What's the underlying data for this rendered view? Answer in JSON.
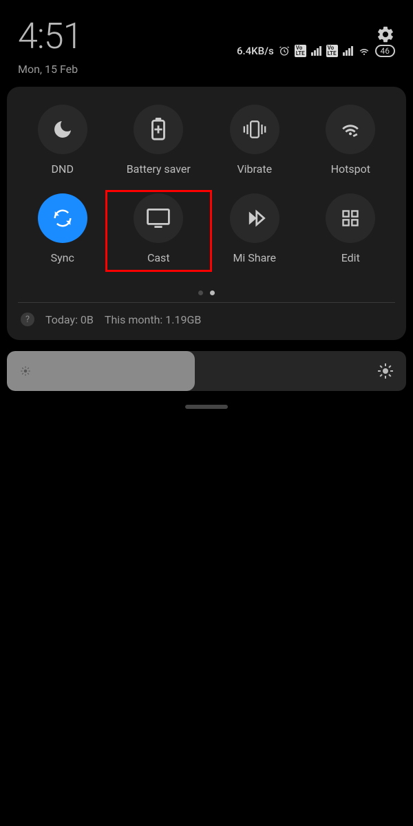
{
  "clock": "4:51",
  "date": "Mon, 15 Feb",
  "network_speed": "6.4KB/s",
  "battery_level": "46",
  "tiles": [
    {
      "label": "DND",
      "icon": "moon",
      "active": false
    },
    {
      "label": "Battery saver",
      "icon": "battery-plus",
      "active": false
    },
    {
      "label": "Vibrate",
      "icon": "vibrate",
      "active": false
    },
    {
      "label": "Hotspot",
      "icon": "hotspot",
      "active": false
    },
    {
      "label": "Sync",
      "icon": "sync",
      "active": true
    },
    {
      "label": "Cast",
      "icon": "cast",
      "active": false,
      "highlighted": true
    },
    {
      "label": "Mi Share",
      "icon": "mishare",
      "active": false
    },
    {
      "label": "Edit",
      "icon": "grid",
      "active": false
    }
  ],
  "pager": {
    "current": 1,
    "total": 2
  },
  "usage": {
    "today_label": "Today:",
    "today_value": "0B",
    "month_label": "This month:",
    "month_value": "1.19GB"
  },
  "brightness_percent": 47,
  "colors": {
    "accent": "#1a8cff",
    "highlight": "#ff0000"
  }
}
